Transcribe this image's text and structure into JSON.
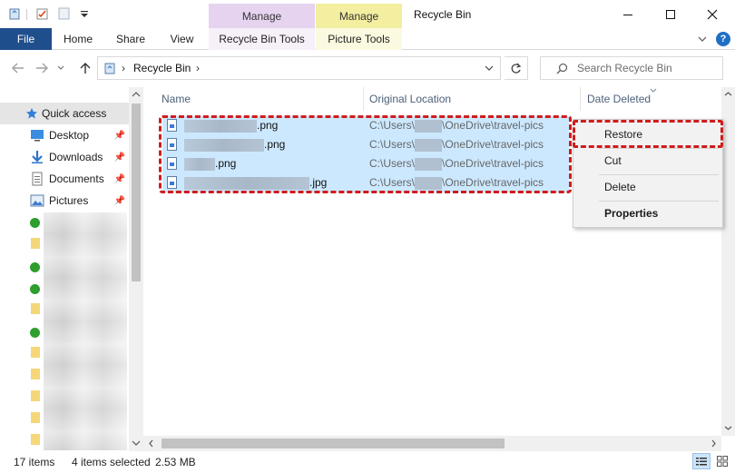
{
  "window": {
    "title": "Recycle Bin",
    "context_tabs": [
      "Manage",
      "Manage"
    ]
  },
  "ribbon": {
    "file": "File",
    "home": "Home",
    "share": "Share",
    "view": "View",
    "recycle_bin_tools": "Recycle Bin Tools",
    "picture_tools": "Picture Tools"
  },
  "address": {
    "path_separator": "›",
    "location": "Recycle Bin",
    "search_placeholder": "Search Recycle Bin"
  },
  "nav": {
    "quick_access": "Quick access",
    "items": [
      "Desktop",
      "Downloads",
      "Documents",
      "Pictures"
    ]
  },
  "columns": {
    "name": "Name",
    "original_location": "Original Location",
    "date_deleted": "Date Deleted"
  },
  "files": [
    {
      "name_suffix": ".png",
      "location_prefix": "C:\\Users\\",
      "location_suffix": "\\OneDrive\\travel-pics"
    },
    {
      "name_suffix": ".png",
      "location_prefix": "C:\\Users\\",
      "location_suffix": "\\OneDrive\\travel-pics"
    },
    {
      "name_suffix": ".png",
      "location_prefix": "C:\\Users\\",
      "location_suffix": "\\OneDrive\\travel-pics"
    },
    {
      "name_suffix": ".jpg",
      "location_prefix": "C:\\Users\\",
      "location_suffix": "\\OneDrive\\travel-pics"
    }
  ],
  "context_menu": {
    "restore": "Restore",
    "cut": "Cut",
    "delete": "Delete",
    "properties": "Properties"
  },
  "status": {
    "item_count": "17 items",
    "selection": "4 items selected",
    "size": "2.53 MB"
  },
  "colors": {
    "file_tab": "#1f4e8c",
    "selection": "#cce8ff",
    "highlight_dash": "#d01c1c"
  }
}
